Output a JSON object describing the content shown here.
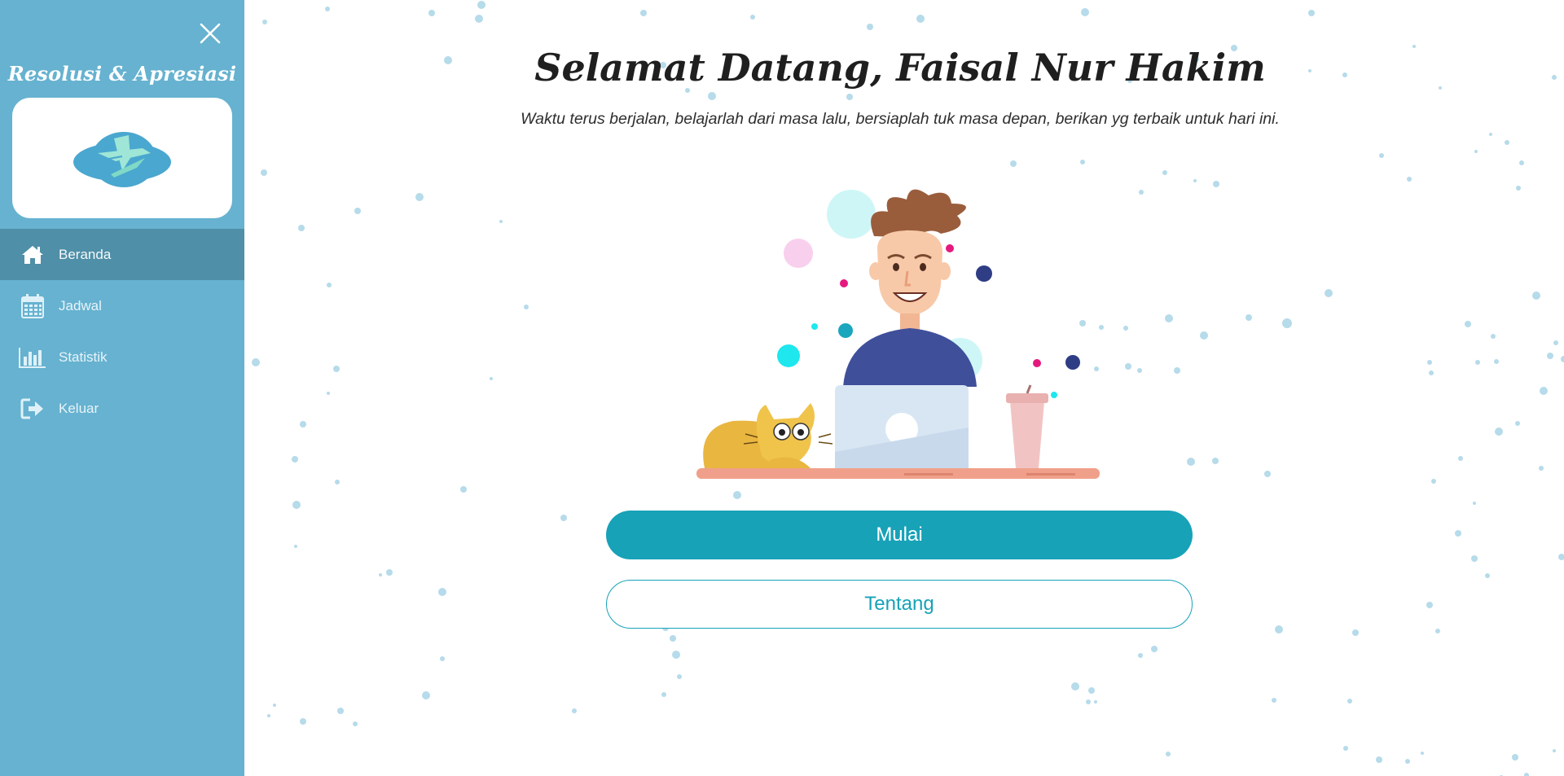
{
  "sidebar": {
    "brand": "Resolusi & Apresiasi",
    "items": [
      {
        "label": "Beranda",
        "icon": "home-icon",
        "active": true
      },
      {
        "label": "Jadwal",
        "icon": "calendar-icon",
        "active": false
      },
      {
        "label": "Statistik",
        "icon": "bar-chart-icon",
        "active": false
      },
      {
        "label": "Keluar",
        "icon": "sign-out-icon",
        "active": false
      }
    ],
    "close_icon": "close-icon",
    "logo_icon": "airplane-logo-icon"
  },
  "main": {
    "title": "Selamat Datang, Faisal Nur Hakim",
    "subtitle": "Waktu terus berjalan, belajarlah dari masa lalu, bersiaplah tuk masa depan, berikan yg terbaik untuk hari ini.",
    "start_label": "Mulai",
    "about_label": "Tentang"
  },
  "colors": {
    "sidebar": "#66b2d0",
    "sidebar_active": "#4f8fa8",
    "accent": "#17a2b8",
    "particles": "#b6dbea"
  }
}
